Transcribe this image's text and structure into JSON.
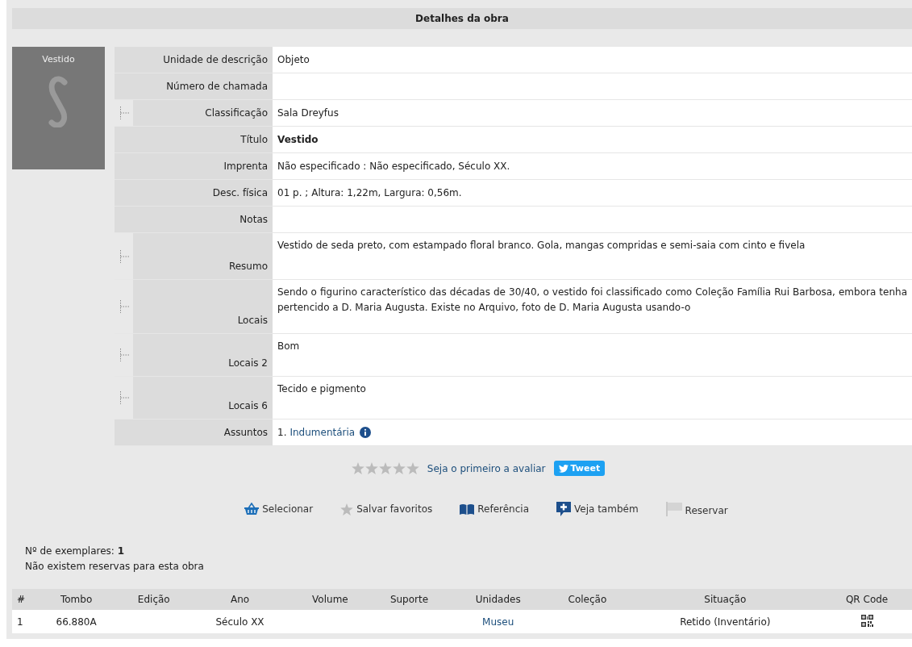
{
  "header": {
    "title": "Detalhes da obra"
  },
  "cover": {
    "title": "Vestido"
  },
  "fields": [
    {
      "label": "Unidade de descrição",
      "kind": "plain",
      "value": "Objeto"
    },
    {
      "label": "Número de chamada",
      "kind": "plain"
    },
    {
      "label": "Classificação",
      "kind": "tree",
      "value": "Sala Dreyfus"
    },
    {
      "label": "Título",
      "kind": "plain",
      "value": "Vestido",
      "bold": true
    },
    {
      "label": "Imprenta",
      "kind": "plain",
      "value": "Não especificado : Não especificado, Século XX."
    },
    {
      "label": "Desc. física",
      "kind": "plain",
      "value": "01 p. ; Altura: 1,22m, Largura: 0,56m."
    },
    {
      "label": "Notas",
      "kind": "plain"
    },
    {
      "label": "Resumo",
      "kind": "tree-tall",
      "value": "Vestido de seda preto, com estampado floral branco. Gola, mangas compridas e semi-saia com cinto e fivela"
    },
    {
      "label": "Locais",
      "kind": "tree-tall",
      "value": "Sendo o figurino característico das décadas de 30/40, o vestido foi classificado como Coleção Família Rui Barbosa, embora tenha pertencido a D. Maria Augusta. Existe no Arquivo, foto de D. Maria Augusta usando-o"
    },
    {
      "label": "Locais 2",
      "kind": "tree-tall",
      "value": "Bom"
    },
    {
      "label": "Locais 6",
      "kind": "tree-tall",
      "value": "Tecido e pigmento"
    },
    {
      "label": "Assuntos",
      "kind": "subjects",
      "subjects": [
        {
          "number": "1.",
          "link": "Indumentária"
        }
      ]
    }
  ],
  "rating": {
    "stars": 0,
    "prompt": "Seja o primeiro a avaliar",
    "tweet": "Tweet"
  },
  "actions": [
    {
      "kind": "basket",
      "label": "Selecionar"
    },
    {
      "kind": "star",
      "label": "Salvar favoritos"
    },
    {
      "kind": "book",
      "label": "Referência"
    },
    {
      "kind": "plus",
      "label": "Veja também"
    },
    {
      "kind": "flag",
      "label": "Reservar"
    }
  ],
  "copies": {
    "label": "Nº de exemplares:",
    "count": "1",
    "note": "Não existem reservas para esta obra"
  },
  "table": {
    "columns": [
      {
        "label": "#",
        "kind": "text"
      },
      {
        "label": "Tombo",
        "kind": "text"
      },
      {
        "label": "Edição",
        "kind": "text"
      },
      {
        "label": "Ano",
        "kind": "text"
      },
      {
        "label": "Volume",
        "kind": "text"
      },
      {
        "label": "Suporte",
        "kind": "text"
      },
      {
        "label": "Unidades",
        "kind": "link"
      },
      {
        "label": "Coleção",
        "kind": "text"
      },
      {
        "label": "Situação",
        "kind": "text"
      },
      {
        "label": "QR Code",
        "kind": "qr"
      }
    ],
    "rows": [
      [
        "1",
        "66.880A",
        null,
        "Século XX",
        null,
        null,
        "Museu",
        null,
        "Retido (Inventário)",
        null
      ]
    ]
  }
}
